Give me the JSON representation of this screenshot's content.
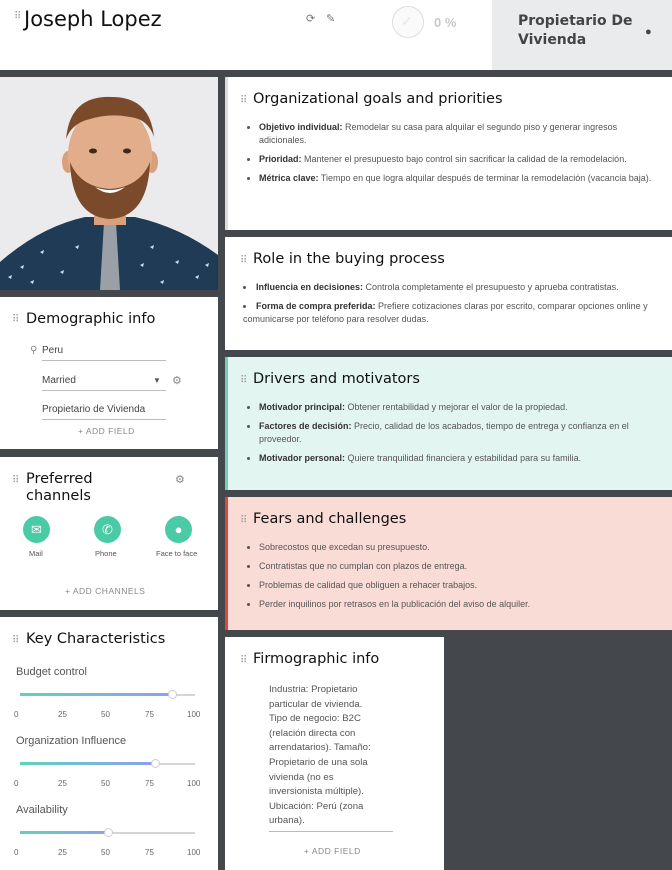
{
  "header": {
    "name": "Joseph Lopez",
    "progress_text": "0 %",
    "role": "Propietario De Vivienda"
  },
  "demographic": {
    "title": "Demographic info",
    "location": "Peru",
    "marital_status": "Married",
    "occupation": "Propietario de Vivienda",
    "add_field": "+ ADD FIELD"
  },
  "channels": {
    "title": "Preferred channels",
    "items": [
      {
        "label": "Mail",
        "icon": "mail-icon"
      },
      {
        "label": "Phone",
        "icon": "phone-icon"
      },
      {
        "label": "Face to face",
        "icon": "person-icon"
      }
    ],
    "add_channels": "+ ADD CHANNELS"
  },
  "key_characteristics": {
    "title": "Key Characteristics",
    "ticks": [
      "0",
      "25",
      "50",
      "75",
      "100"
    ],
    "sliders": [
      {
        "label": "Budget control",
        "value": 87
      },
      {
        "label": "Organization Influence",
        "value": 77
      },
      {
        "label": "Availability",
        "value": 50
      }
    ]
  },
  "goals": {
    "title": "Organizational goals and priorities",
    "items": [
      {
        "key": "Objetivo individual:",
        "text": " Remodelar su casa para alquilar el segundo piso y generar ingresos adicionales."
      },
      {
        "key": "Prioridad:",
        "text": " Mantener el presupuesto bajo control sin sacrificar la calidad de la remodelación."
      },
      {
        "key": "Métrica clave:",
        "text": " Tiempo en que logra alquilar después de terminar la remodelación (vacancia baja)."
      }
    ]
  },
  "buying": {
    "title": "Role in the buying process",
    "items": [
      {
        "key": "Influencia en decisiones:",
        "text": " Controla completamente el presupuesto y aprueba contratistas."
      },
      {
        "key": "Forma de compra preferida:",
        "text": " Prefiere cotizaciones claras por escrito, comparar opciones online y comunicarse por teléfono para resolver dudas."
      }
    ]
  },
  "drivers": {
    "title": "Drivers and motivators",
    "items": [
      {
        "key": "Motivador principal:",
        "text": " Obtener rentabilidad y mejorar el valor de la propiedad."
      },
      {
        "key": "Factores de decisión:",
        "text": " Precio, calidad de los acabados, tiempo de entrega y confianza en el proveedor."
      },
      {
        "key": "Motivador personal:",
        "text": " Quiere tranquilidad financiera y estabilidad para su familia."
      }
    ]
  },
  "fears": {
    "title": "Fears and challenges",
    "items": [
      "Sobrecostos que excedan su presupuesto.",
      "Contratistas que no cumplan con plazos de entrega.",
      "Problemas de calidad que obliguen a rehacer trabajos.",
      "Perder inquilinos por retrasos en la publicación del aviso de alquiler."
    ]
  },
  "firmographic": {
    "title": "Firmographic info",
    "text": "Industria: Propietario particular de vivienda. Tipo de negocio: B2C (relación directa con arrendatarios). Tamaño: Propietario de una sola vivienda (no es inversionista múltiple). Ubicación: Perú (zona urbana).",
    "add_field": "+ ADD FIELD"
  },
  "colors": {
    "accent_teal": "#4bcaa6",
    "slider_gradient_end": "#8f9ff0",
    "fears_border": "#e0463b",
    "drivers_bg": "#e3f5f0",
    "fears_bg": "#fadcd7"
  }
}
